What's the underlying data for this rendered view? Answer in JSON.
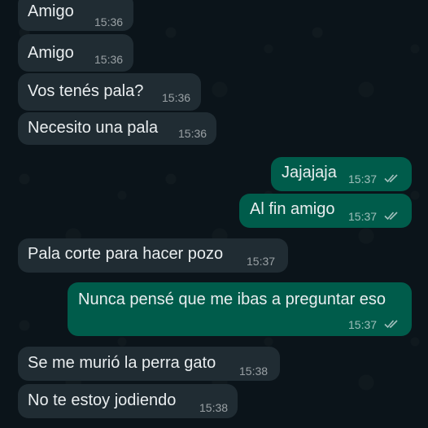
{
  "messages": [
    {
      "direction": "incoming",
      "text": "Amigo",
      "time": "15:36"
    },
    {
      "direction": "incoming",
      "text": "Amigo",
      "time": "15:36"
    },
    {
      "direction": "incoming",
      "text": "Vos tenés pala?",
      "time": "15:36"
    },
    {
      "direction": "incoming",
      "text": "Necesito una pala",
      "time": "15:36"
    },
    {
      "direction": "outgoing",
      "text": "Jajajaja",
      "time": "15:37",
      "status": "read-ticks-icon"
    },
    {
      "direction": "outgoing",
      "text": "Al fin amigo",
      "time": "15:37",
      "status": "read-ticks-icon"
    },
    {
      "direction": "incoming",
      "text": "Pala corte para hacer pozo",
      "time": "15:37"
    },
    {
      "direction": "outgoing",
      "text": "Nunca pensé que me ibas a preguntar eso",
      "time": "15:37",
      "status": "read-ticks-icon"
    },
    {
      "direction": "incoming",
      "text": "Se me murió la perra gato",
      "time": "15:38"
    },
    {
      "direction": "incoming",
      "text": "No te estoy jodiendo",
      "time": "15:38"
    }
  ],
  "colors": {
    "background": "#0b141a",
    "incoming_bubble": "#202c33",
    "outgoing_bubble": "#005c4b",
    "text": "#e9edef"
  }
}
